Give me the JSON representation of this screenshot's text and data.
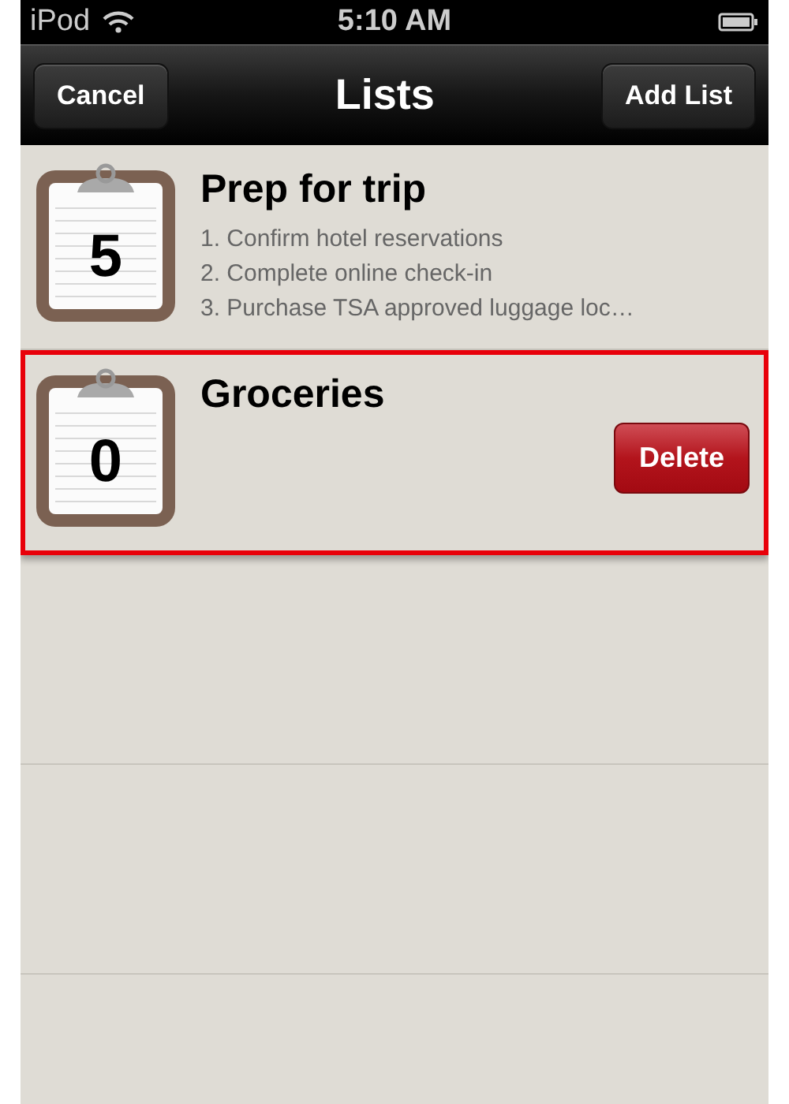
{
  "status_bar": {
    "carrier": "iPod",
    "time": "5:10 AM"
  },
  "nav_bar": {
    "left_button": "Cancel",
    "title": "Lists",
    "right_button": "Add List"
  },
  "lists": [
    {
      "name": "Prep for trip",
      "count": "5",
      "preview": [
        "1. Confirm hotel reservations",
        "2. Complete online check-in",
        "3. Purchase TSA approved luggage loc…"
      ],
      "highlighted": false
    },
    {
      "name": "Groceries",
      "count": "0",
      "delete_label": "Delete",
      "highlighted": true
    }
  ]
}
